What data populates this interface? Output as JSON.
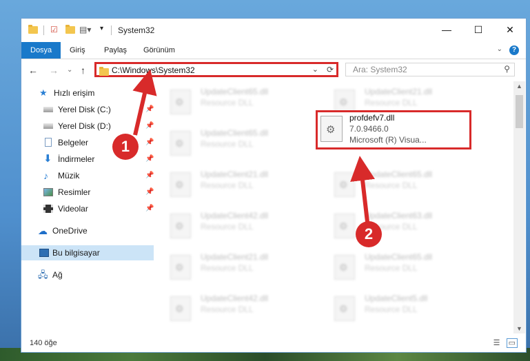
{
  "window": {
    "title": "System32",
    "minimize_glyph": "—",
    "maximize_glyph": "☐",
    "close_glyph": "✕"
  },
  "ribbon": {
    "tabs": [
      "Dosya",
      "Giriş",
      "Paylaş",
      "Görünüm"
    ],
    "help_glyph": "?",
    "expand_glyph": "⌄"
  },
  "nav": {
    "back_glyph": "←",
    "forward_glyph": "→",
    "recent_glyph": "⌄",
    "up_glyph": "↑",
    "address": "C:\\Windows\\System32",
    "dropdown_glyph": "⌄",
    "refresh_glyph": "⟳",
    "search_placeholder": "Ara: System32",
    "search_glyph": "⚲"
  },
  "sidebar": {
    "items": [
      {
        "label": "Hızlı erişim",
        "icon": "star-icon"
      },
      {
        "label": "Yerel Disk (C:)",
        "icon": "drive-icon",
        "pin": "📌"
      },
      {
        "label": "Yerel Disk (D:)",
        "icon": "drive-icon",
        "pin": "📌"
      },
      {
        "label": "Belgeler",
        "icon": "document-icon",
        "pin": "📌"
      },
      {
        "label": "İndirmeler",
        "icon": "download-icon",
        "pin": "📌"
      },
      {
        "label": "Müzik",
        "icon": "music-icon",
        "pin": "📌"
      },
      {
        "label": "Resimler",
        "icon": "pictures-icon",
        "pin": "📌"
      },
      {
        "label": "Videolar",
        "icon": "video-icon",
        "pin": "📌"
      },
      {
        "label": "OneDrive",
        "icon": "cloud-icon"
      },
      {
        "label": "Bu bilgisayar",
        "icon": "computer-icon"
      },
      {
        "label": "Ağ",
        "icon": "network-icon"
      }
    ]
  },
  "files": [
    {
      "name": "UpdateClient65.dll",
      "desc": "Resource DLL"
    },
    {
      "name": "UpdateClient21.dll",
      "desc": "Resource DLL"
    },
    {
      "name": "UpdateClient65.dll",
      "desc": "Resource DLL"
    },
    {
      "name": "UpdateClient21.dll",
      "desc": "Resource DLL"
    },
    {
      "name": "UpdateClient65.dll",
      "desc": "Resource DLL"
    },
    {
      "name": "UpdateClient42.dll",
      "desc": "Resource DLL"
    },
    {
      "name": "UpdateClient63.dll",
      "desc": "Resource DLL"
    },
    {
      "name": "UpdateClient21.dll",
      "desc": "Resource DLL"
    },
    {
      "name": "UpdateClient65.dll",
      "desc": "Resource DLL"
    },
    {
      "name": "UpdateClient42.dll",
      "desc": "Resource DLL"
    },
    {
      "name": "UpdateClient5.dll",
      "desc": "Resource DLL"
    }
  ],
  "highlighted_file": {
    "name": "profdefv7.dll",
    "version": "7.0.9466.0",
    "company": "Microsoft (R) Visua..."
  },
  "status": {
    "count": "140 öğe"
  },
  "callouts": [
    "1",
    "2"
  ],
  "colors": {
    "accent": "#1979ca",
    "highlight": "#d82a2a",
    "selected": "#cce4f7"
  }
}
